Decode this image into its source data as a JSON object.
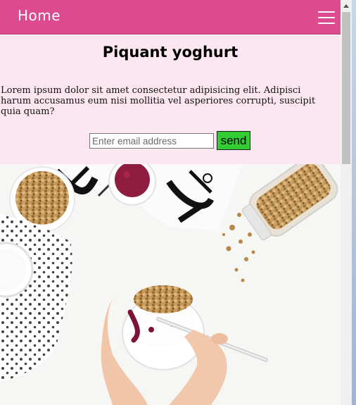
{
  "navbar": {
    "home_label": "Home",
    "background": "#dd4a90",
    "menu_icon": "hamburger-menu-icon"
  },
  "intro": {
    "title": "Piquant yoghurt",
    "text": "Lorem ipsum dolor sit amet consectetur adipisicing elit. Adipisci harum accusamus eum nisi mollitia vel asperiores corrupti, suscipit quia quam?",
    "background": "#fce6f0"
  },
  "signup": {
    "email_placeholder": "Enter email address",
    "email_value": "",
    "send_label": "send",
    "send_color": "#33cc33"
  },
  "scrollbar": {
    "up_icon": "scroll-up-arrow-icon"
  }
}
